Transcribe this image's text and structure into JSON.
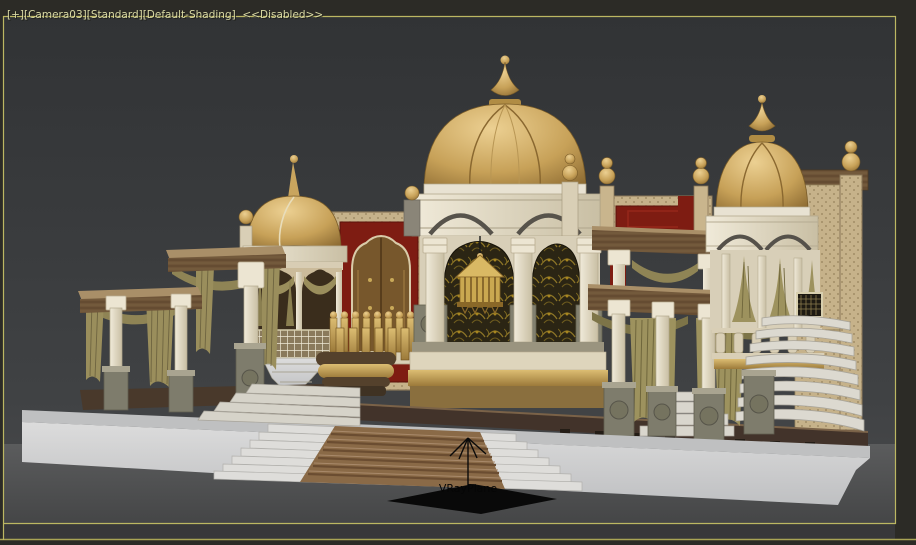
{
  "app": "3ds-max-viewport",
  "viewport": {
    "label_full": "[+][Camera03][Standard][Default-Shading]  <<Disabled>>",
    "label_segments": [
      "[+]",
      "[Camera03]",
      "[Standard]",
      "[Default-Shading]",
      "<<Disabled>>"
    ],
    "label_color": "#d8d8a4",
    "border_color": "#bcb762",
    "frame_color": "#2c2b26",
    "background_top": "#313335",
    "background_bottom": "#494a4c"
  },
  "scene": {
    "helper": {
      "label": "VRayPlane",
      "label_color": "#060606",
      "icon": "up-arrow-plane-helper"
    },
    "description": "Ornate golden Indian wedding-stage palace set: three gold-domed pavilions, carved dark-gold arch panels, red door panels, olive drapes on colonnades, kalash fence, white platform with carpeted grand staircase, VRayPlane helper on the floor in front",
    "structures": [
      "left-pergola",
      "left-dome-pavilion",
      "ornate-door-panel",
      "kalash-fence",
      "central-dome-pavilion",
      "chandelier",
      "right-colonnade",
      "right-dome-pavilion",
      "stage-floor",
      "white-platform",
      "grand-staircase",
      "vrayplane-helper"
    ],
    "palette": {
      "dome_gold": "#c9a55e",
      "dome_gold_dark": "#8a6830",
      "cream": "#ece5d2",
      "cream_shadow": "#b9ad92",
      "curtain_olive": "#9d925e",
      "curtain_olive_dark": "#6f663c",
      "panel_red": "#7e1c12",
      "wood_brown": "#6e5438",
      "carved_panel_dark": "#2b2514",
      "carved_panel_gold": "#8d7526",
      "stone_gray": "#7e7c6c",
      "platform_white": "#d2d2d3",
      "floor_gray": "#525354",
      "stage_floor_brown": "#42332a",
      "vray_plane_black": "#090909"
    }
  }
}
